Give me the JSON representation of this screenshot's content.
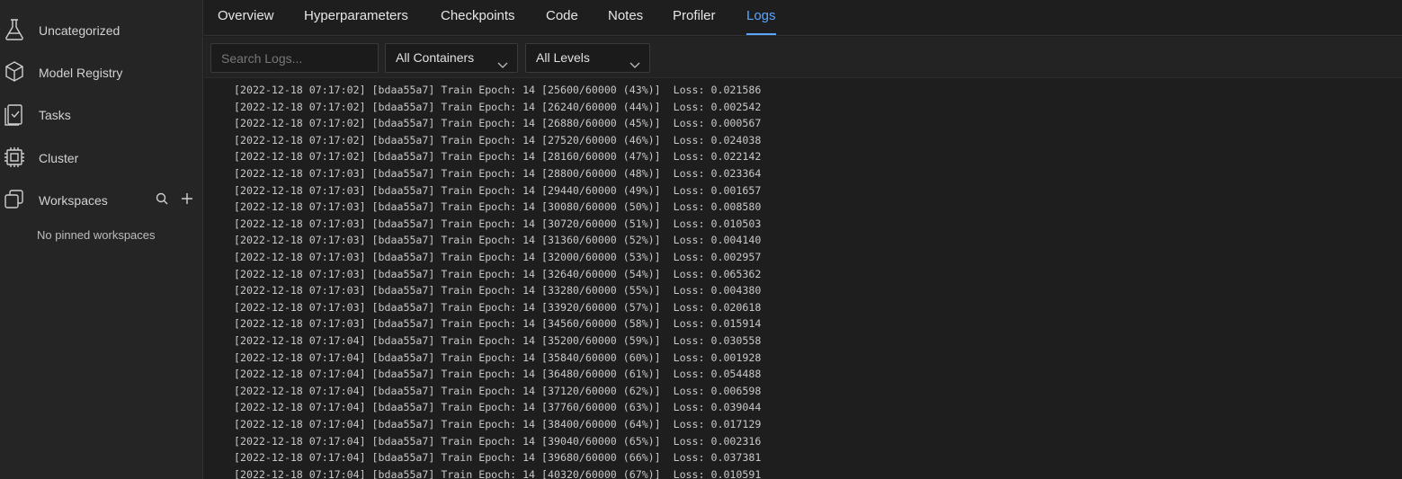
{
  "sidebar": {
    "items": [
      {
        "label": "Uncategorized",
        "icon": "flask-icon"
      },
      {
        "label": "Model Registry",
        "icon": "cube-icon"
      },
      {
        "label": "Tasks",
        "icon": "tasks-icon"
      },
      {
        "label": "Cluster",
        "icon": "chip-icon"
      },
      {
        "label": "Workspaces",
        "icon": "workspaces-icon"
      }
    ],
    "empty_note": "No pinned workspaces"
  },
  "tabs": [
    "Overview",
    "Hyperparameters",
    "Checkpoints",
    "Code",
    "Notes",
    "Profiler",
    "Logs"
  ],
  "active_tab": "Logs",
  "toolbar": {
    "search_placeholder": "Search Logs...",
    "containers": "All Containers",
    "levels": "All Levels"
  },
  "logs": [
    "[2022-12-18 07:17:02] [bdaa55a7] Train Epoch: 14 [25600/60000 (43%)]  Loss: 0.021586",
    "[2022-12-18 07:17:02] [bdaa55a7] Train Epoch: 14 [26240/60000 (44%)]  Loss: 0.002542",
    "[2022-12-18 07:17:02] [bdaa55a7] Train Epoch: 14 [26880/60000 (45%)]  Loss: 0.000567",
    "[2022-12-18 07:17:02] [bdaa55a7] Train Epoch: 14 [27520/60000 (46%)]  Loss: 0.024038",
    "[2022-12-18 07:17:02] [bdaa55a7] Train Epoch: 14 [28160/60000 (47%)]  Loss: 0.022142",
    "[2022-12-18 07:17:03] [bdaa55a7] Train Epoch: 14 [28800/60000 (48%)]  Loss: 0.023364",
    "[2022-12-18 07:17:03] [bdaa55a7] Train Epoch: 14 [29440/60000 (49%)]  Loss: 0.001657",
    "[2022-12-18 07:17:03] [bdaa55a7] Train Epoch: 14 [30080/60000 (50%)]  Loss: 0.008580",
    "[2022-12-18 07:17:03] [bdaa55a7] Train Epoch: 14 [30720/60000 (51%)]  Loss: 0.010503",
    "[2022-12-18 07:17:03] [bdaa55a7] Train Epoch: 14 [31360/60000 (52%)]  Loss: 0.004140",
    "[2022-12-18 07:17:03] [bdaa55a7] Train Epoch: 14 [32000/60000 (53%)]  Loss: 0.002957",
    "[2022-12-18 07:17:03] [bdaa55a7] Train Epoch: 14 [32640/60000 (54%)]  Loss: 0.065362",
    "[2022-12-18 07:17:03] [bdaa55a7] Train Epoch: 14 [33280/60000 (55%)]  Loss: 0.004380",
    "[2022-12-18 07:17:03] [bdaa55a7] Train Epoch: 14 [33920/60000 (57%)]  Loss: 0.020618",
    "[2022-12-18 07:17:03] [bdaa55a7] Train Epoch: 14 [34560/60000 (58%)]  Loss: 0.015914",
    "[2022-12-18 07:17:04] [bdaa55a7] Train Epoch: 14 [35200/60000 (59%)]  Loss: 0.030558",
    "[2022-12-18 07:17:04] [bdaa55a7] Train Epoch: 14 [35840/60000 (60%)]  Loss: 0.001928",
    "[2022-12-18 07:17:04] [bdaa55a7] Train Epoch: 14 [36480/60000 (61%)]  Loss: 0.054488",
    "[2022-12-18 07:17:04] [bdaa55a7] Train Epoch: 14 [37120/60000 (62%)]  Loss: 0.006598",
    "[2022-12-18 07:17:04] [bdaa55a7] Train Epoch: 14 [37760/60000 (63%)]  Loss: 0.039044",
    "[2022-12-18 07:17:04] [bdaa55a7] Train Epoch: 14 [38400/60000 (64%)]  Loss: 0.017129",
    "[2022-12-18 07:17:04] [bdaa55a7] Train Epoch: 14 [39040/60000 (65%)]  Loss: 0.002316",
    "[2022-12-18 07:17:04] [bdaa55a7] Train Epoch: 14 [39680/60000 (66%)]  Loss: 0.037381",
    "[2022-12-18 07:17:04] [bdaa55a7] Train Epoch: 14 [40320/60000 (67%)]  Loss: 0.010591"
  ]
}
